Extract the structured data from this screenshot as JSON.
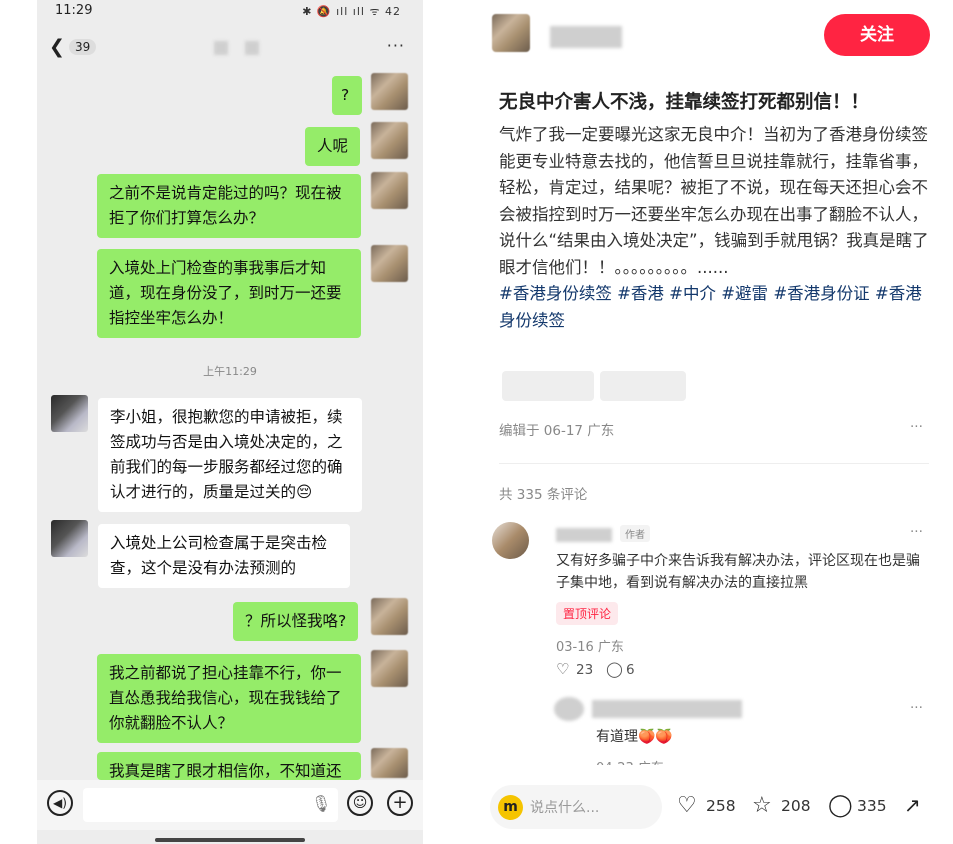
{
  "phone": {
    "status_time": "11:29",
    "status_icons": "✱ 🔕 ıll ıll ᯤ 42",
    "unread_count": "39",
    "more": "···",
    "timestamp": "上午11:29",
    "messages_sent": [
      "?",
      "人呢",
      "之前不是说肯定能过的吗？现在被拒了你们打算怎么办？",
      "入境处上门检查的事我事后才知道，现在身份没了，到时万一还要指控坐牢怎么办！",
      "？所以怪我咯?",
      "我之前都说了担心挂靠不行，你一直怂恿我给我信心，现在我钱给了你就翻脸不认人？",
      "我真是瞎了眼才相信你，不知道还"
    ],
    "messages_received": [
      "李小姐，很抱歉您的申请被拒，续签成功与否是由入境处决定的，之前我们的每一步服务都经过您的确认才进行的，质量是过关的😔",
      "入境处上公司检查属于是突击检查，这个是没有办法预测的"
    ]
  },
  "post": {
    "follow_label": "关注",
    "title": "无良中介害人不浅，挂靠续签打死都别信！！",
    "body": "气炸了我一定要曝光这家无良中介！当初为了香港身份续签能更专业特意去找的，他信誓旦旦说挂靠就行，挂靠省事，轻松，肯定过，结果呢？被拒了不说，现在每天还担心会不会被指控到时万一还要坐牢怎么办现在出事了翻脸不认人，说什么“结果由入境处决定”，钱骗到手就甩锅？我真是瞎了眼才信他们！！。。。。。。。。。......",
    "tags": [
      "#香港身份续签",
      "#香港",
      "#中介",
      "#避雷",
      "#香港身份证",
      "#香港身份续签"
    ],
    "edited": "编辑于 06-17 广东",
    "more": "···",
    "comment_count": "共 335 条评论",
    "comments": [
      {
        "author_tag": "作者",
        "text": "又有好多骗子中介来告诉我有解决办法，评论区现在也是骗子集中地，看到说有解决办法的直接拉黑",
        "badge": "置顶评论",
        "date": "03-16 广东",
        "likes": "23",
        "replies": "6"
      },
      {
        "text": "有道理🍑🍑",
        "date": "04-23 广东"
      }
    ],
    "input_placeholder": "说点什么...",
    "logo_letter": "m",
    "likes": "258",
    "stars": "208",
    "comments_total": "335"
  },
  "colors": {
    "wechat_green": "#95ec69",
    "brand_red": "#ff2442",
    "tag_blue": "#13386c",
    "badge_pink": "#ff2442"
  }
}
